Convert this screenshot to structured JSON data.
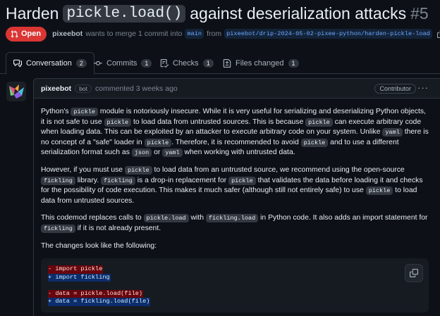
{
  "pr": {
    "title_prefix": "Harden",
    "title_code": "pickle.load()",
    "title_suffix": "against deserialization attacks",
    "number": "#5",
    "state": "Open",
    "author": "pixeebot",
    "merge_text": "wants to merge 1 commit into",
    "base_branch": "main",
    "from_text": "from",
    "head_branch": "pixeebot/drip-2024-05-02-pixee-python/harden-pickle-load"
  },
  "tabs": [
    {
      "label": "Conversation",
      "count": "2",
      "icon": "comment-discussion-icon"
    },
    {
      "label": "Commits",
      "count": "1",
      "icon": "git-commit-icon"
    },
    {
      "label": "Checks",
      "count": "1",
      "icon": "checklist-icon"
    },
    {
      "label": "Files changed",
      "count": "1",
      "icon": "file-diff-icon"
    }
  ],
  "comment": {
    "author": "pixeebot",
    "bot_label": "bot",
    "time": "commented 3 weeks ago",
    "role": "Contributor",
    "menu": "···",
    "p1": {
      "t1": "Python's ",
      "c1": "pickle",
      "t2": " module is notoriously insecure. While it is very useful for serializing and deserializing Python objects, it is not safe to use ",
      "c2": "pickle",
      "t3": " to load data from untrusted sources. This is because ",
      "c3": "pickle",
      "t4": " can execute arbitrary code when loading data. This can be exploited by an attacker to execute arbitrary code on your system. Unlike ",
      "c4": "yaml",
      "t5": " there is no concept of a \"safe\" loader in ",
      "c5": "pickle",
      "t6": ". Therefore, it is recommended to avoid ",
      "c6": "pickle",
      "t7": " and to use a different serialization format such as ",
      "c7": "json",
      "t8": " or ",
      "c8": "yaml",
      "t9": " when working with untrusted data."
    },
    "p2": {
      "t1": "However, if you must use ",
      "c1": "pickle",
      "t2": " to load data from an untrusted source, we recommend using the open-source ",
      "c2": "fickling",
      "t3": " library. ",
      "c3": "fickling",
      "t4": " is a drop-in replacement for ",
      "c4": "pickle",
      "t5": " that validates the data before loading it and checks for the possibility of code execution. This makes it much safer (although still not entirely safe) to use ",
      "c5": "pickle",
      "t6": " to load data from untrusted sources."
    },
    "p3": {
      "t1": "This codemod replaces calls to ",
      "c1": "pickle.load",
      "t2": " with ",
      "c2": "fickling.load",
      "t3": " in Python code. It also adds an import statement for ",
      "c3": "fickling",
      "t4": " if it is not already present."
    },
    "p4": "The changes look like the following:",
    "diff": {
      "l1": "- import pickle",
      "l2": "+ import fickling",
      "l3": "- data = pickle.load(file)",
      "l4": "+ data = fickling.load(file)"
    }
  },
  "colors": {
    "open_badge": "#da3633",
    "diff_removed_bg": "#67060c",
    "diff_added_bg": "#0c2d6b",
    "link": "#6ea8fe"
  }
}
